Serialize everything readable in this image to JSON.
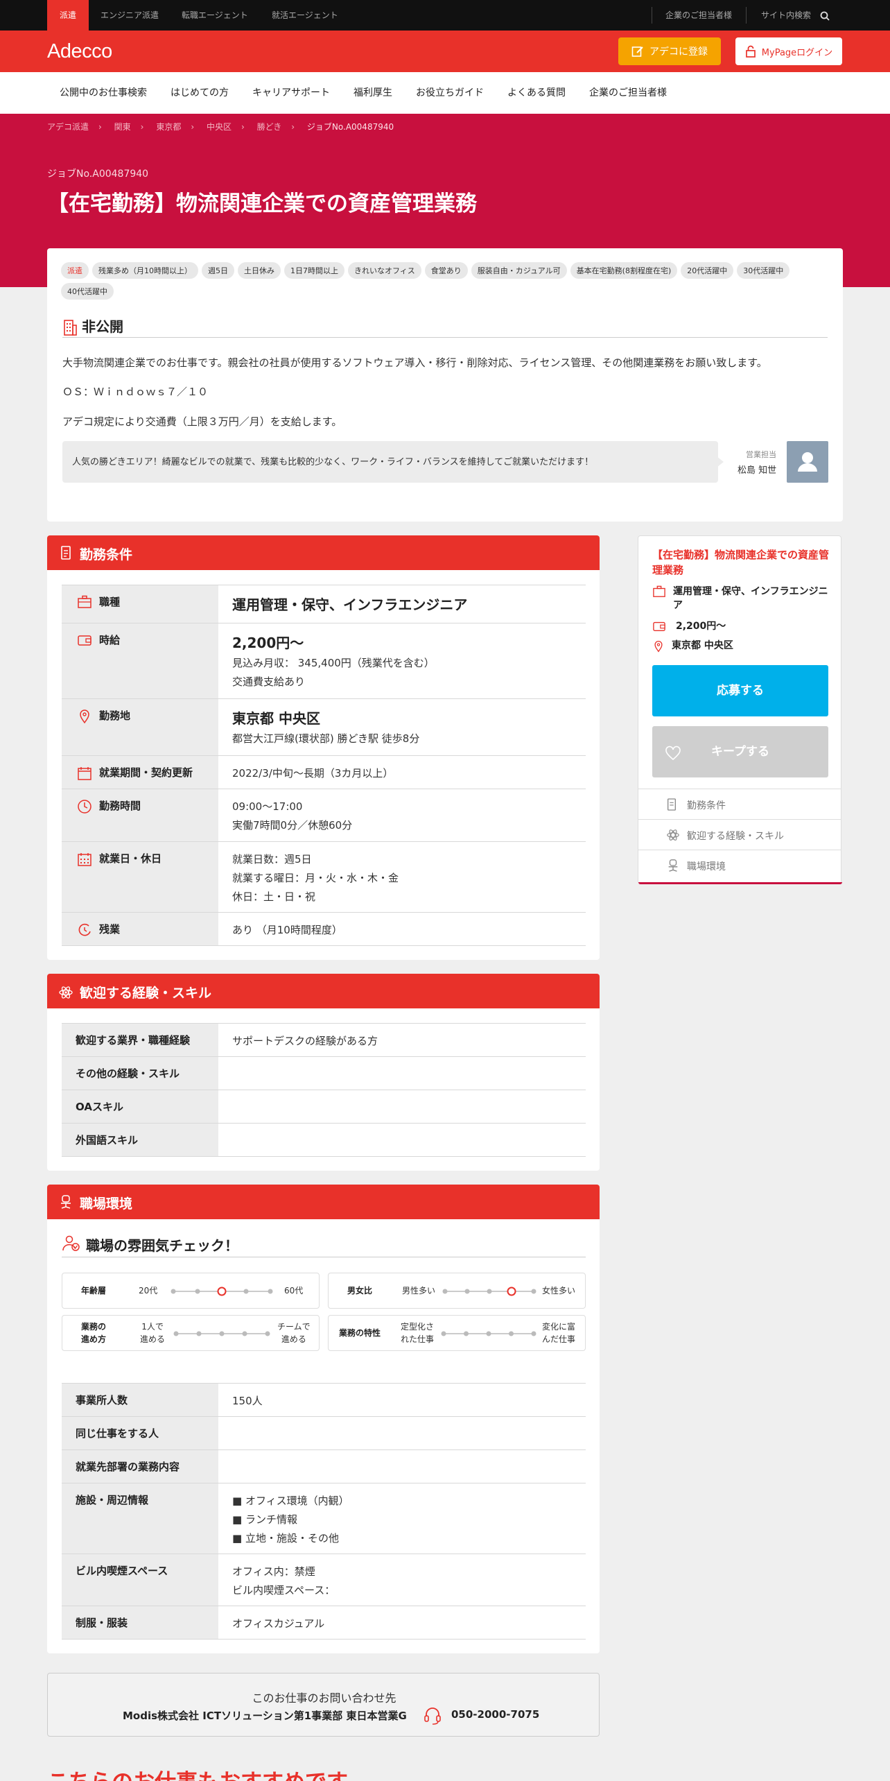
{
  "topbar": {
    "tabs": [
      "派遣",
      "エンジニア派遣",
      "転職エージェント",
      "就活エージェント"
    ],
    "right_links": [
      "企業のご担当者様",
      "サイト内検索"
    ]
  },
  "header": {
    "logo": "Adecco",
    "register": "アデコに登録",
    "login": "MyPageログイン"
  },
  "nav": [
    "公開中のお仕事検索",
    "はじめての方",
    "キャリアサポート",
    "福利厚生",
    "お役立ちガイド",
    "よくある質問",
    "企業のご担当者様"
  ],
  "breadcrumbs": [
    "アデコ派遣",
    "関東",
    "東京都",
    "中央区",
    "勝どき",
    "ジョブNo.A00487940"
  ],
  "job": {
    "number": "ジョブNo.A00487940",
    "title": "【在宅勤務】物流関連企業での資産管理業務"
  },
  "tags": [
    "派遣",
    "残業多め（月10時間以上）",
    "週5日",
    "土日休み",
    "1日7時間以上",
    "きれいなオフィス",
    "食堂あり",
    "服装自由・カジュアル可",
    "基本在宅勤務(8割程度在宅)",
    "20代活躍中",
    "30代活躍中",
    "40代活躍中"
  ],
  "company": {
    "heading": "非公開",
    "desc1": "大手物流関連企業でのお仕事です。親会社の社員が使用するソフトウェア導入・移行・削除対応、ライセンス管理、その他関連業務をお願い致します。",
    "desc2": "ＯＳ：Ｗｉｎｄｏｗｓ７／１０",
    "desc3": "アデコ規定により交通費（上限３万円／月）を支給します。",
    "comment": "人気の勝どきエリア！綺麗なビルでの就業で、残業も比較的少なく、ワーク・ライフ・バランスを維持してご就業いただけます！",
    "staff_label": "営業担当",
    "staff_name": "松島 知世"
  },
  "conditions": {
    "heading": "勤務条件",
    "job_type_label": "職種",
    "job_type": "運用管理・保守、インフラエンジニア",
    "wage_label": "時給",
    "wage": "2,200円～",
    "monthly": "見込み月収： 345,400円（残業代を含む）",
    "transport": "交通費支給あり",
    "location_label": "勤務地",
    "location": "東京都 中央区",
    "station": "都営大江戸線(環状部) 勝どき駅 徒歩8分",
    "period_label": "就業期間・契約更新",
    "period": "2022/3/中旬～長期（3カ月以上）",
    "hours_label": "勤務時間",
    "hours": "09:00～17:00",
    "hours_detail": "実働7時間0分／休憩60分",
    "days_label": "就業日・休日",
    "days1": "就業日数：週5日",
    "days2": "就業する曜日：月・火・水・木・金",
    "days3": "休日：土・日・祝",
    "overtime_label": "残業",
    "overtime": "あり （月10時間程度）"
  },
  "skills": {
    "heading": "歓迎する経験・スキル",
    "rows": [
      {
        "label": "歓迎する業界・職種経験",
        "value": "サポートデスクの経験がある方"
      },
      {
        "label": "その他の経験・スキル",
        "value": ""
      },
      {
        "label": "OAスキル",
        "value": ""
      },
      {
        "label": "外国語スキル",
        "value": ""
      }
    ]
  },
  "environment": {
    "heading": "職場環境",
    "atmosphere_heading": "職場の雰囲気チェック！",
    "scales": [
      {
        "label": "年齢層",
        "left": "20代",
        "right": "60代",
        "selected": 2
      },
      {
        "label": "男女比",
        "left": "男性多い",
        "right": "女性多い",
        "selected": 3
      },
      {
        "label": "業務の\n進め方",
        "left": "1人で\n進める",
        "right": "チームで\n進める",
        "selected": null
      },
      {
        "label": "業務の特性",
        "left": "定型化さ\nれた仕事",
        "right": "変化に富\nんだ仕事",
        "selected": null
      }
    ],
    "employees_label": "事業所人数",
    "employees": "150人",
    "same_job_label": "同じ仕事をする人",
    "same_job": "",
    "dept_label": "就業先部署の業務内容",
    "dept": "",
    "facility_label": "施設・周辺情報",
    "facility1": "■ オフィス環境（内観）",
    "facility2": "■ ランチ情報",
    "facility3": "■ 立地・施設・その他",
    "smoking_label": "ビル内喫煙スペース",
    "smoking1": "オフィス内：禁煙",
    "smoking2": "ビル内喫煙スペース：",
    "uniform_label": "制服・服装",
    "uniform": "オフィスカジュアル"
  },
  "sidebar": {
    "title": "【在宅勤務】物流関連企業での資産管理業務",
    "job_type": "運用管理・保守、インフラエンジニア",
    "wage": "2,200円～",
    "location": "東京都 中央区",
    "apply": "応募する",
    "keep": "キープする",
    "links": [
      "勤務条件",
      "歓迎する経験・スキル",
      "職場環境"
    ]
  },
  "contact": {
    "label": "このお仕事のお問い合わせ先",
    "company": "Modis株式会社 ICTソリューション第1事業部 東日本営業G",
    "phone": "050-2000-7075"
  },
  "recommend": "こちらのお仕事もおすすめです",
  "colors": {
    "brand": "#e8312a",
    "hero": "#c8103e",
    "apply": "#00b0ea",
    "register": "#f5a300"
  }
}
